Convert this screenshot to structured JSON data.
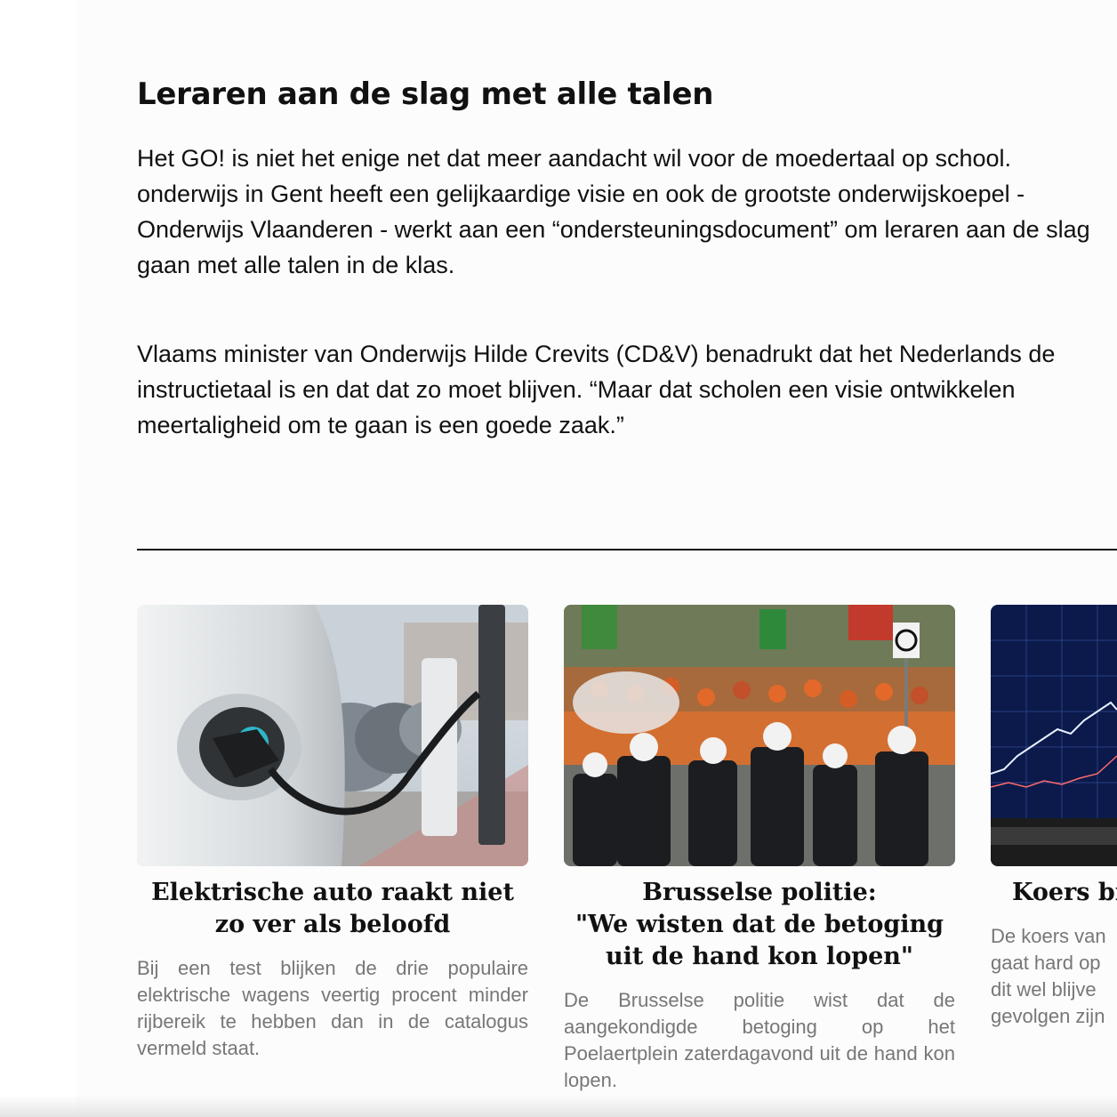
{
  "article": {
    "heading": "Leraren aan de slag met alle talen",
    "paragraph1_lines": [
      "Het GO! is niet het enige net dat meer aandacht wil voor de moedertaal op school.",
      "onderwijs in Gent heeft een gelijkaardige visie en ook de grootste onderwijskoepel -",
      "Onderwijs Vlaanderen - werkt aan een “ondersteuningsdocument” om leraren aan de slag",
      "gaan met alle talen in de klas."
    ],
    "paragraph2_lines": [
      "Vlaams minister van Onderwijs Hilde Crevits (CD&V) benadrukt dat het Nederlands de",
      "instructietaal is en dat dat zo moet blijven. “Maar dat scholen een visie ontwikkelen",
      "meertaligheid om te gaan is een goede zaak.”"
    ]
  },
  "related": [
    {
      "image": "electric-car-charging-image",
      "title_lines": [
        "Elektrische auto raakt niet",
        "zo ver als beloofd"
      ],
      "summary": "Bij een test blijken de drie populaire elektrische wagens veertig procent minder rijbereik te hebben dan in de catalogus vermeld staat."
    },
    {
      "image": "riot-police-protest-image",
      "title_lines": [
        "Brusselse politie:",
        "\"We wisten dat de betoging",
        "uit de hand kon lopen\""
      ],
      "summary": "De Brusselse politie wist dat de aangekondigde betoging op het Poelaertplein zaterdagavond uit de hand kon lopen."
    },
    {
      "image": "stock-chart-screen-image",
      "title_lines": [
        "Koers bit"
      ],
      "summary_lines": [
        "De koers van",
        "gaat hard op",
        "dit wel blijve",
        "gevolgen zijn"
      ]
    }
  ],
  "colors": {
    "text": "#111111",
    "summary_text": "#777777",
    "background": "#fcfcfc"
  }
}
